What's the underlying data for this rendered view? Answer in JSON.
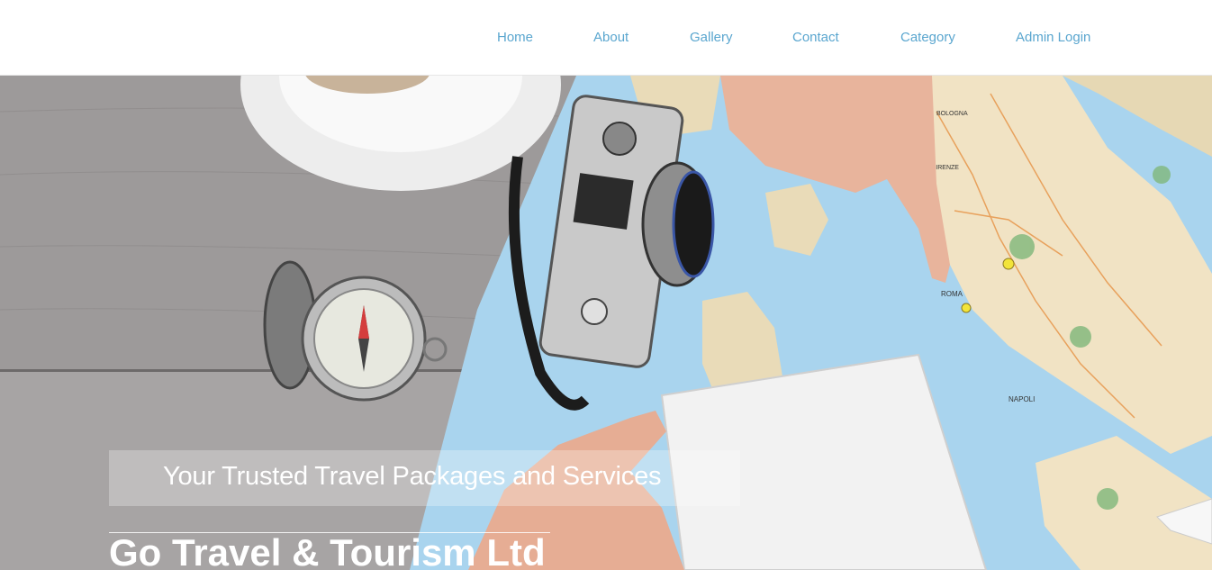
{
  "nav": {
    "items": [
      {
        "label": "Home"
      },
      {
        "label": "About"
      },
      {
        "label": "Gallery"
      },
      {
        "label": "Contact"
      },
      {
        "label": "Category"
      },
      {
        "label": "Admin Login"
      }
    ]
  },
  "hero": {
    "tagline": "Your Trusted Travel Packages and Services",
    "brand": "Go Travel & Tourism Ltd",
    "map_labels": {
      "city_1": "ROMA",
      "city_2": "NAPOLI",
      "city_3": "FIRENZE",
      "city_4": "BOLOGNA"
    }
  },
  "colors": {
    "nav_link": "#5aa6cf",
    "wood": "#9a9797",
    "map_sea": "#a9d4ee",
    "map_land": "#f1e3c4"
  }
}
